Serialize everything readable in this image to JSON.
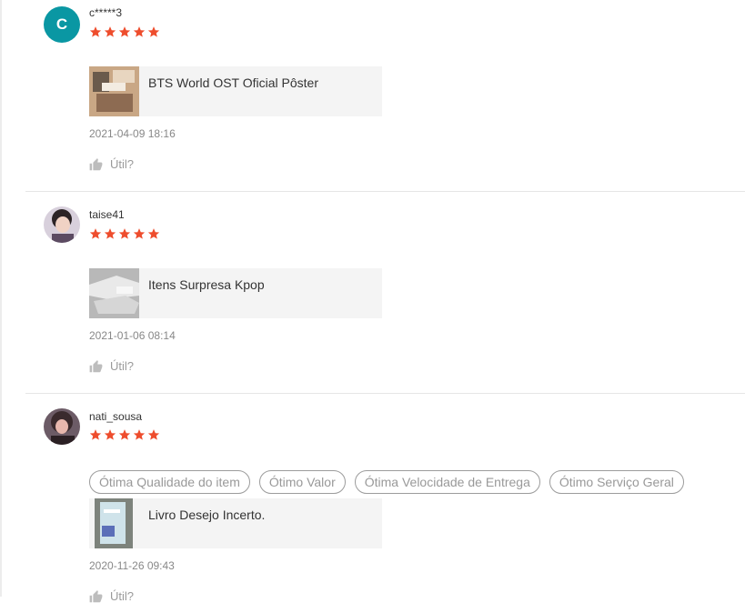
{
  "reviews": [
    {
      "username": "c*****3",
      "avatar_letter": "C",
      "rating": 5,
      "product_name": "BTS World OST Oficial Pôster",
      "date": "2021-04-09 18:16",
      "helpful_label": "Útil?"
    },
    {
      "username": "taise41",
      "rating": 5,
      "product_name": "Itens Surpresa Kpop",
      "date": "2021-01-06 08:14",
      "helpful_label": "Útil?"
    },
    {
      "username": "nati_sousa",
      "rating": 5,
      "tags": [
        "Ótima Qualidade do item",
        "Ótimo Valor",
        "Ótima Velocidade de Entrega",
        "Ótimo Serviço Geral"
      ],
      "product_name": "Livro Desejo Incerto.",
      "date": "2020-11-26 09:43",
      "helpful_label": "Útil?"
    }
  ],
  "colors": {
    "star": "#ee4d2d",
    "avatar_bg": "#0a97a3",
    "divider": "#e6e6e6"
  },
  "icons": {
    "star": "star-icon",
    "helpful": "thumbs-up-icon"
  }
}
